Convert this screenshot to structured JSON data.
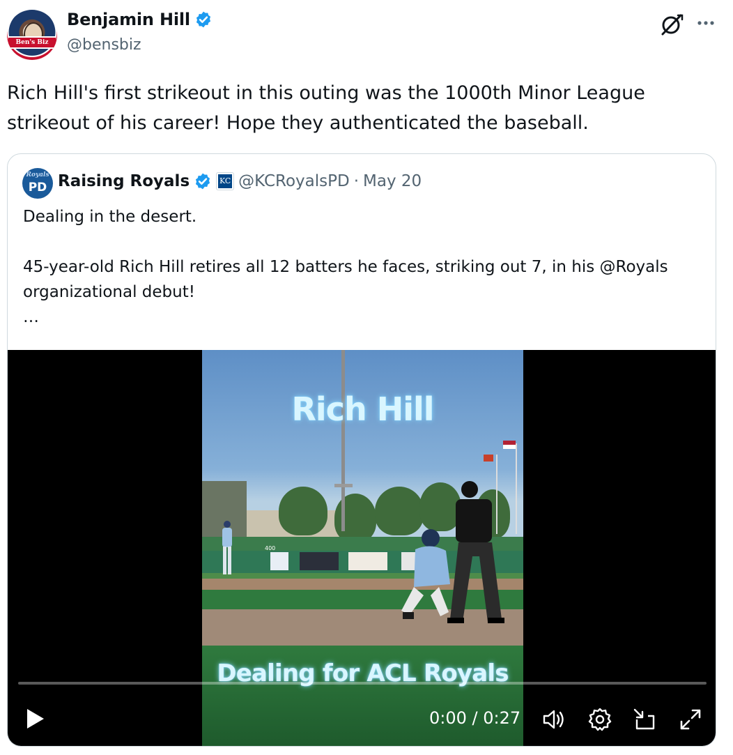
{
  "author": {
    "name": "Benjamin Hill",
    "handle": "@bensbiz",
    "avatar_text": "Ben's Biz",
    "verified": true
  },
  "tweet": {
    "text": "Rich Hill's first strikeout in this outing was the 1000th Minor League strikeout of his career! Hope they authenticated the baseball."
  },
  "quoted": {
    "avatar_top": "Royals",
    "avatar_text": "PD",
    "name": "Raising Royals",
    "org_badge": "KC",
    "handle": "@KCRoyalsPD",
    "separator": "·",
    "date": "May 20",
    "text": "Dealing in the desert.\n\n45-year-old Rich Hill retires all 12 batters he faces, striking out 7, in his @Royals organizational debut!\n…"
  },
  "video": {
    "overlay_title": "Rich Hill",
    "overlay_subtitle": "Dealing for ACL Royals",
    "time": "0:00 / 0:27",
    "progress": 0,
    "outfield_sign": "400",
    "controls": [
      "play-icon",
      "volume-icon",
      "settings-icon",
      "minimize-icon",
      "fullscreen-icon"
    ]
  },
  "colors": {
    "accent": "#1d9bf0",
    "text": "#0f1419",
    "secondary": "#536471",
    "border": "#cfd9de"
  }
}
